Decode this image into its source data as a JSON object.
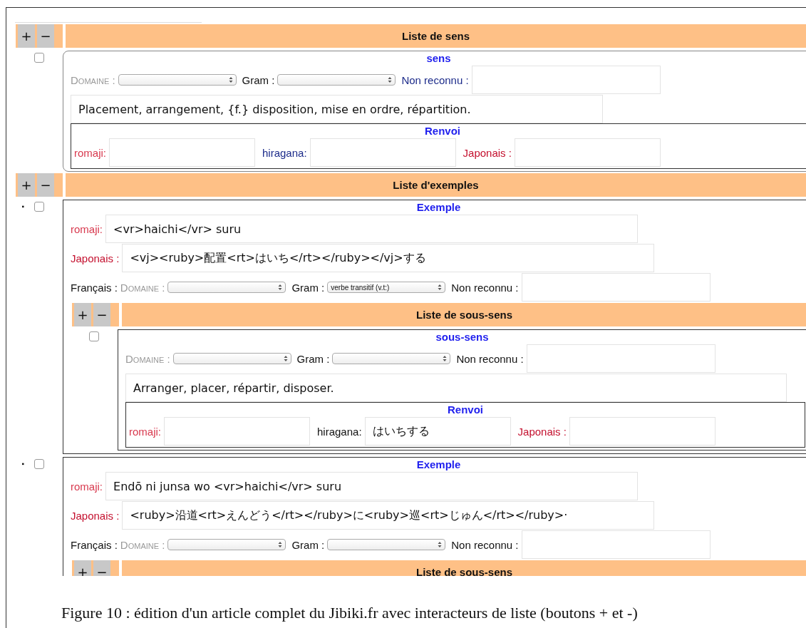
{
  "sens_list": {
    "add": "+",
    "remove": "−",
    "title": "Liste de sens",
    "senses": [
      {
        "checked": false,
        "heading": "sens",
        "domaine_label": "Domaine :",
        "gram_label": "Gram :",
        "non_reconnu_label": "Non reconnu :",
        "definition": "Placement, arrangement, {f.} disposition, mise en ordre, répartition.",
        "renvoi": {
          "heading": "Renvoi",
          "romaji_label": "romaji:",
          "hiragana_label": "hiragana:",
          "japonais_label": "Japonais :"
        }
      }
    ]
  },
  "examples_list": {
    "add": "+",
    "remove": "−",
    "title": "Liste d'exemples",
    "examples": [
      {
        "bullet": "▪",
        "checked": false,
        "heading": "Exemple",
        "romaji_label": "romaji:",
        "romaji": "<vr>haichi</vr> suru",
        "japonais_label": "Japonais :",
        "japonais": "<vj><ruby>配置<rt>はいち</rt></ruby></vj>する",
        "francais_label": "Français :",
        "domaine_label": "Domaine :",
        "gram_label": "Gram :",
        "gram_value": "verbe transitif (v.t:)",
        "non_reconnu_label": "Non reconnu :",
        "subsenses": {
          "add": "+",
          "remove": "−",
          "title": "Liste de sous-sens",
          "items": [
            {
              "checked": false,
              "heading": "sous-sens",
              "domaine_label": "Domaine :",
              "gram_label": "Gram :",
              "non_reconnu_label": "Non reconnu :",
              "definition": "Arranger, placer, répartir, disposer.",
              "renvoi": {
                "heading": "Renvoi",
                "romaji_label": "romaji:",
                "hiragana_label": "hiragana:",
                "hiragana_value": "はいちする",
                "japonais_label": "Japonais :"
              }
            }
          ]
        }
      },
      {
        "bullet": "▪",
        "checked": false,
        "heading": "Exemple",
        "romaji_label": "romaji:",
        "romaji": "Endō ni junsa wo <vr>haichi</vr> suru",
        "japonais_label": "Japonais :",
        "japonais": "<ruby>沿道<rt>えんどう</rt></ruby>に<ruby>巡<rt>じゅん</rt></ruby>·",
        "francais_label": "Français :",
        "domaine_label": "Domaine :",
        "gram_label": "Gram :",
        "non_reconnu_label": "Non reconnu :",
        "subsenses": {
          "add": "+",
          "remove": "−",
          "title": "Liste de sous-sens"
        }
      }
    ]
  },
  "caption": "Figure 10 : édition d'un article complet du Jibiki.fr avec interacteurs de liste (boutons + et -)"
}
